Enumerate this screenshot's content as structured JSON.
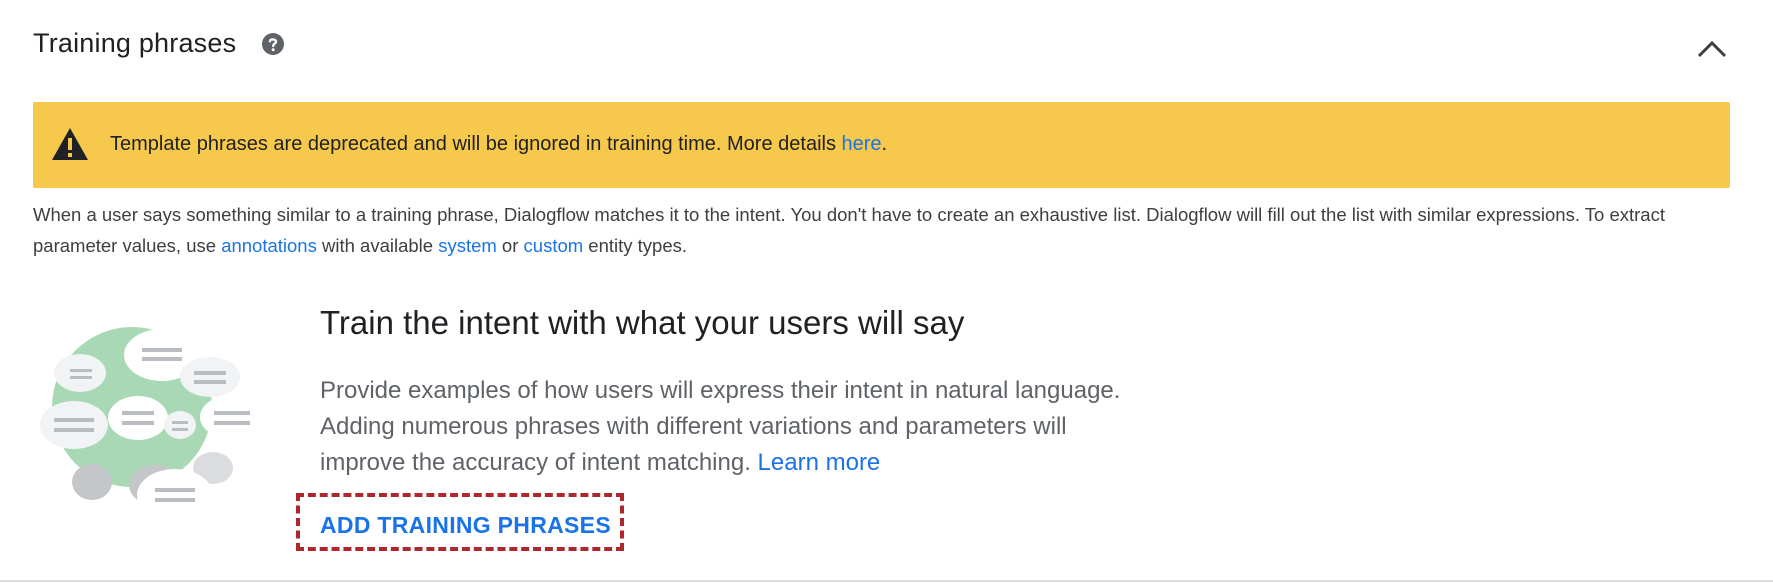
{
  "header": {
    "title": "Training phrases",
    "help_icon": "help-circle-icon",
    "collapse_icon": "chevron-up-icon"
  },
  "warning": {
    "icon": "warning-triangle-icon",
    "text": "Template phrases are deprecated and will be ignored in training time. More details ",
    "link": "here",
    "suffix": ".",
    "bg_color": "#f6c94c"
  },
  "description": {
    "part1": "When a user says something similar to a training phrase, Dialogflow matches it to the intent. You don't have to create an exhaustive list. Dialogflow will fill out the list with similar expressions. To extract parameter values, use ",
    "link_annotations": "annotations",
    "part2": " with available ",
    "link_system": "system",
    "part3": " or ",
    "link_custom": "custom",
    "part4": " entity types."
  },
  "empty_state": {
    "illustration": "chat-bubbles-illustration",
    "title": "Train the intent with what your users will say",
    "body_line1": "Provide examples of how users will express their intent in natural language.",
    "body_line2": "Adding numerous phrases with different variations and parameters will",
    "body_line3": "improve the accuracy of intent matching. ",
    "learn_more": "Learn more",
    "add_button": "ADD TRAINING PHRASES"
  },
  "colors": {
    "link": "#1a73e8",
    "highlight_border": "#b0262d"
  }
}
